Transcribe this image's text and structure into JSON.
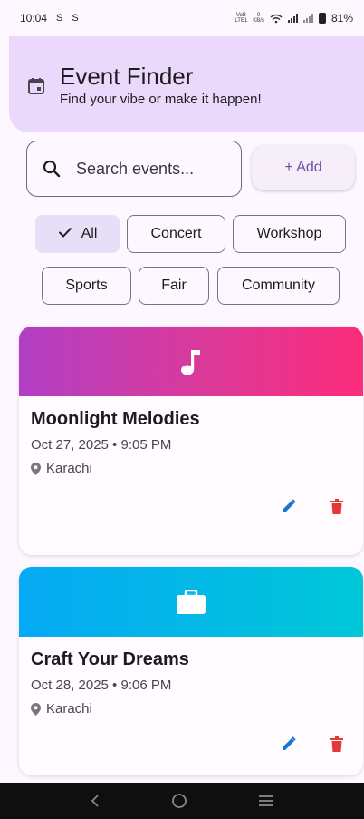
{
  "status_bar": {
    "time": "10:04",
    "left_icons": [
      "S",
      "S"
    ],
    "network_label_top": "VoB",
    "network_label_bottom": "LTE1",
    "speed_top": "0",
    "speed_bottom": "KB/s",
    "battery": "81%"
  },
  "header": {
    "icon": "calendar-icon",
    "title": "Event Finder",
    "subtitle": "Find your vibe or make it happen!",
    "background": "#ead9fb"
  },
  "search": {
    "placeholder": "Search events..."
  },
  "add_button": {
    "label": "+ Add"
  },
  "filters": [
    {
      "label": "All",
      "selected": true
    },
    {
      "label": "Concert",
      "selected": false
    },
    {
      "label": "Workshop",
      "selected": false
    },
    {
      "label": "Sports",
      "selected": false
    },
    {
      "label": "Fair",
      "selected": false
    },
    {
      "label": "Community",
      "selected": false
    }
  ],
  "events": [
    {
      "title": "Moonlight Melodies",
      "datetime": "Oct 27, 2025 • 9:05 PM",
      "location": "Karachi",
      "banner_icon": "music-note-icon",
      "gradient": [
        "#b13fc4",
        "#fb2c7b"
      ]
    },
    {
      "title": "Craft Your Dreams",
      "datetime": "Oct 28, 2025 • 9:06 PM",
      "location": "Karachi",
      "banner_icon": "briefcase-icon",
      "gradient": [
        "#05a9f4",
        "#00c8d8"
      ]
    }
  ],
  "colors": {
    "accent": "#6750a4",
    "edit": "#1976d2",
    "delete": "#e53935"
  }
}
